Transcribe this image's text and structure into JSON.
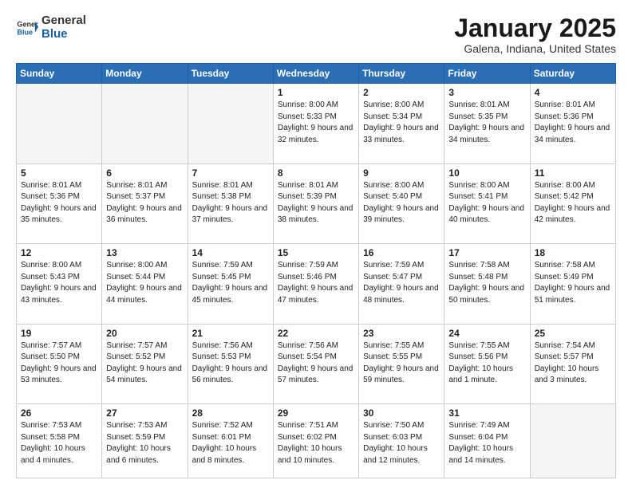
{
  "header": {
    "logo_general": "General",
    "logo_blue": "Blue",
    "month_title": "January 2025",
    "location": "Galena, Indiana, United States"
  },
  "weekdays": [
    "Sunday",
    "Monday",
    "Tuesday",
    "Wednesday",
    "Thursday",
    "Friday",
    "Saturday"
  ],
  "weeks": [
    [
      {
        "day": "",
        "info": ""
      },
      {
        "day": "",
        "info": ""
      },
      {
        "day": "",
        "info": ""
      },
      {
        "day": "1",
        "info": "Sunrise: 8:00 AM\nSunset: 5:33 PM\nDaylight: 9 hours\nand 32 minutes."
      },
      {
        "day": "2",
        "info": "Sunrise: 8:00 AM\nSunset: 5:34 PM\nDaylight: 9 hours\nand 33 minutes."
      },
      {
        "day": "3",
        "info": "Sunrise: 8:01 AM\nSunset: 5:35 PM\nDaylight: 9 hours\nand 34 minutes."
      },
      {
        "day": "4",
        "info": "Sunrise: 8:01 AM\nSunset: 5:36 PM\nDaylight: 9 hours\nand 34 minutes."
      }
    ],
    [
      {
        "day": "5",
        "info": "Sunrise: 8:01 AM\nSunset: 5:36 PM\nDaylight: 9 hours\nand 35 minutes."
      },
      {
        "day": "6",
        "info": "Sunrise: 8:01 AM\nSunset: 5:37 PM\nDaylight: 9 hours\nand 36 minutes."
      },
      {
        "day": "7",
        "info": "Sunrise: 8:01 AM\nSunset: 5:38 PM\nDaylight: 9 hours\nand 37 minutes."
      },
      {
        "day": "8",
        "info": "Sunrise: 8:01 AM\nSunset: 5:39 PM\nDaylight: 9 hours\nand 38 minutes."
      },
      {
        "day": "9",
        "info": "Sunrise: 8:00 AM\nSunset: 5:40 PM\nDaylight: 9 hours\nand 39 minutes."
      },
      {
        "day": "10",
        "info": "Sunrise: 8:00 AM\nSunset: 5:41 PM\nDaylight: 9 hours\nand 40 minutes."
      },
      {
        "day": "11",
        "info": "Sunrise: 8:00 AM\nSunset: 5:42 PM\nDaylight: 9 hours\nand 42 minutes."
      }
    ],
    [
      {
        "day": "12",
        "info": "Sunrise: 8:00 AM\nSunset: 5:43 PM\nDaylight: 9 hours\nand 43 minutes."
      },
      {
        "day": "13",
        "info": "Sunrise: 8:00 AM\nSunset: 5:44 PM\nDaylight: 9 hours\nand 44 minutes."
      },
      {
        "day": "14",
        "info": "Sunrise: 7:59 AM\nSunset: 5:45 PM\nDaylight: 9 hours\nand 45 minutes."
      },
      {
        "day": "15",
        "info": "Sunrise: 7:59 AM\nSunset: 5:46 PM\nDaylight: 9 hours\nand 47 minutes."
      },
      {
        "day": "16",
        "info": "Sunrise: 7:59 AM\nSunset: 5:47 PM\nDaylight: 9 hours\nand 48 minutes."
      },
      {
        "day": "17",
        "info": "Sunrise: 7:58 AM\nSunset: 5:48 PM\nDaylight: 9 hours\nand 50 minutes."
      },
      {
        "day": "18",
        "info": "Sunrise: 7:58 AM\nSunset: 5:49 PM\nDaylight: 9 hours\nand 51 minutes."
      }
    ],
    [
      {
        "day": "19",
        "info": "Sunrise: 7:57 AM\nSunset: 5:50 PM\nDaylight: 9 hours\nand 53 minutes."
      },
      {
        "day": "20",
        "info": "Sunrise: 7:57 AM\nSunset: 5:52 PM\nDaylight: 9 hours\nand 54 minutes."
      },
      {
        "day": "21",
        "info": "Sunrise: 7:56 AM\nSunset: 5:53 PM\nDaylight: 9 hours\nand 56 minutes."
      },
      {
        "day": "22",
        "info": "Sunrise: 7:56 AM\nSunset: 5:54 PM\nDaylight: 9 hours\nand 57 minutes."
      },
      {
        "day": "23",
        "info": "Sunrise: 7:55 AM\nSunset: 5:55 PM\nDaylight: 9 hours\nand 59 minutes."
      },
      {
        "day": "24",
        "info": "Sunrise: 7:55 AM\nSunset: 5:56 PM\nDaylight: 10 hours\nand 1 minute."
      },
      {
        "day": "25",
        "info": "Sunrise: 7:54 AM\nSunset: 5:57 PM\nDaylight: 10 hours\nand 3 minutes."
      }
    ],
    [
      {
        "day": "26",
        "info": "Sunrise: 7:53 AM\nSunset: 5:58 PM\nDaylight: 10 hours\nand 4 minutes."
      },
      {
        "day": "27",
        "info": "Sunrise: 7:53 AM\nSunset: 5:59 PM\nDaylight: 10 hours\nand 6 minutes."
      },
      {
        "day": "28",
        "info": "Sunrise: 7:52 AM\nSunset: 6:01 PM\nDaylight: 10 hours\nand 8 minutes."
      },
      {
        "day": "29",
        "info": "Sunrise: 7:51 AM\nSunset: 6:02 PM\nDaylight: 10 hours\nand 10 minutes."
      },
      {
        "day": "30",
        "info": "Sunrise: 7:50 AM\nSunset: 6:03 PM\nDaylight: 10 hours\nand 12 minutes."
      },
      {
        "day": "31",
        "info": "Sunrise: 7:49 AM\nSunset: 6:04 PM\nDaylight: 10 hours\nand 14 minutes."
      },
      {
        "day": "",
        "info": ""
      }
    ]
  ]
}
